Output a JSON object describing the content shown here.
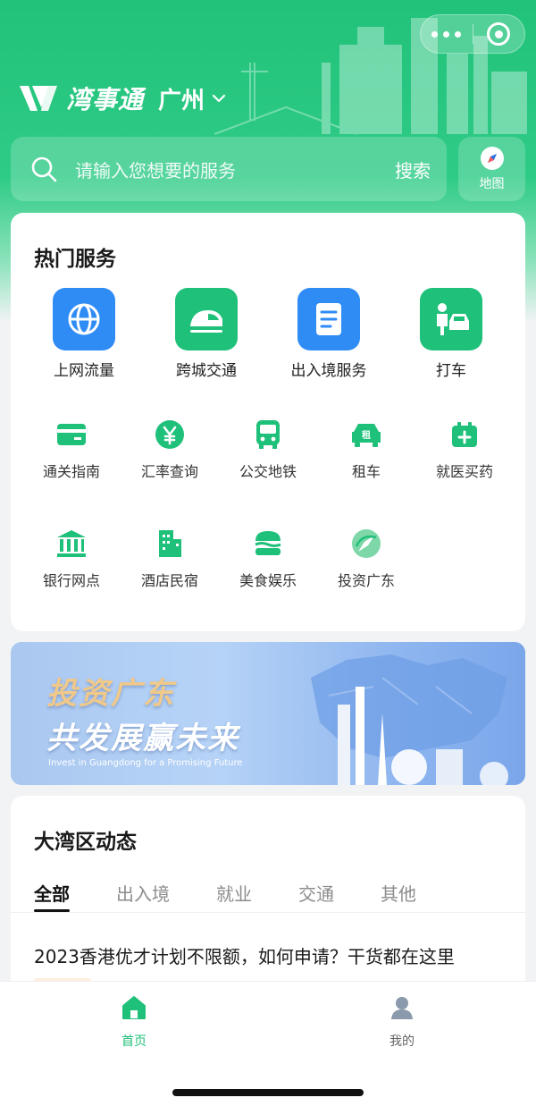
{
  "header": {
    "app_name": "湾事通",
    "city": "广州",
    "colors": {
      "brand_green": "#21c27a"
    }
  },
  "search": {
    "placeholder": "请输入您想要的服务",
    "button_label": "搜索",
    "map_label": "地图"
  },
  "hot_services": {
    "title": "热门服务",
    "featured": [
      {
        "label": "上网流量",
        "icon": "globe-icon",
        "color": "#2f8cf5"
      },
      {
        "label": "跨城交通",
        "icon": "high-speed-train-icon",
        "color": "#1fc07a"
      },
      {
        "label": "出入境服务",
        "icon": "boarding-document-icon",
        "color": "#2f8cf5"
      },
      {
        "label": "打车",
        "icon": "ride-hailing-icon",
        "color": "#1fc07a"
      }
    ],
    "grid": [
      {
        "label": "通关指南",
        "icon": "card-icon"
      },
      {
        "label": "汇率查询",
        "icon": "yen-icon"
      },
      {
        "label": "公交地铁",
        "icon": "bus-icon"
      },
      {
        "label": "租车",
        "icon": "rental-car-icon",
        "badge": "租"
      },
      {
        "label": "就医买药",
        "icon": "medical-kit-icon"
      },
      {
        "label": "银行网点",
        "icon": "bank-icon"
      },
      {
        "label": "酒店民宿",
        "icon": "hotel-icon"
      },
      {
        "label": "美食娱乐",
        "icon": "burger-icon"
      },
      {
        "label": "投资广东",
        "icon": "invest-compass-icon"
      }
    ]
  },
  "banner": {
    "line1": "投资广东",
    "line2": "共发展赢未来",
    "caption": "Invest in Guangdong for a Promising Future"
  },
  "news": {
    "title": "大湾区动态",
    "tabs": [
      "全部",
      "出入境",
      "就业",
      "交通",
      "其他"
    ],
    "active_tab": "全部",
    "headline": "2023香港优才计划不限额，如何申请？干货都在这里"
  },
  "tabbar": {
    "items": [
      {
        "label": "首页",
        "icon": "home-icon",
        "active": true
      },
      {
        "label": "我的",
        "icon": "user-icon",
        "active": false
      }
    ]
  }
}
